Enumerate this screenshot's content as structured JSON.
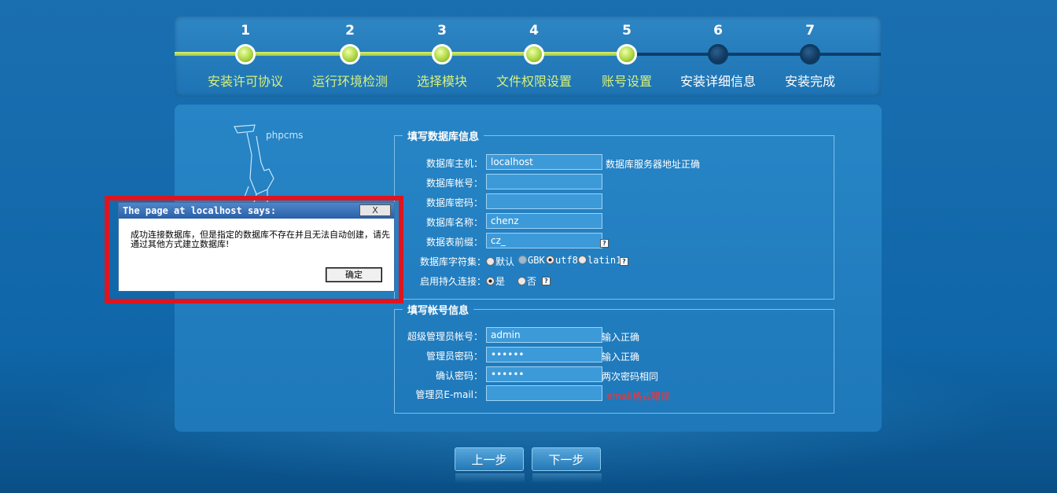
{
  "steps": [
    {
      "num": "1",
      "label": "安装许可协议",
      "done": true
    },
    {
      "num": "2",
      "label": "运行环境检测",
      "done": true
    },
    {
      "num": "3",
      "label": "选择模块",
      "done": true
    },
    {
      "num": "4",
      "label": "文件权限设置",
      "done": true
    },
    {
      "num": "5",
      "label": "账号设置",
      "done": true
    },
    {
      "num": "6",
      "label": "安装详细信息",
      "done": false
    },
    {
      "num": "7",
      "label": "安装完成",
      "done": false
    }
  ],
  "logo": {
    "text": "phpcms"
  },
  "db": {
    "legend": "填写数据库信息",
    "host_label": "数据库主机：",
    "host_value": "localhost",
    "host_hint": "数据库服务器地址正确",
    "user_label": "数据库帐号：",
    "user_value": "",
    "pass_label": "数据库密码：",
    "pass_value": "",
    "name_label": "数据库名称：",
    "name_value": "chenz",
    "prefix_label": "数据表前缀：",
    "prefix_value": "cz_",
    "charset_label": "数据库字符集：",
    "charset_options": [
      "默认",
      "GBK",
      "utf8",
      "latin1"
    ],
    "charset_selected": "utf8",
    "pconnect_label": "启用持久连接：",
    "pconnect_yes": "是",
    "pconnect_no": "否",
    "help_glyph": "?"
  },
  "account": {
    "legend": "填写帐号信息",
    "admin_label": "超级管理员帐号：",
    "admin_value": "admin",
    "admin_hint": "输入正确",
    "pwd_label": "管理员密码：",
    "pwd_value": "••••••",
    "pwd_hint": "输入正确",
    "confirm_label": "确认密码：",
    "confirm_value": "••••••",
    "confirm_hint": "两次密码相同",
    "email_label": "管理员E-mail：",
    "email_value": "",
    "email_hint": "email格式错误"
  },
  "buttons": {
    "prev": "上一步",
    "next": "下一步"
  },
  "dialog": {
    "title": "The page at localhost says:",
    "close": "X",
    "message": "成功连接数据库，但是指定的数据库不存在并且无法自动创建，请先通过其他方式建立数据库!",
    "ok": "确定"
  },
  "colors": {
    "highlight": "#e0141e",
    "step_done": "#d6f17a",
    "error": "#ff3030"
  }
}
